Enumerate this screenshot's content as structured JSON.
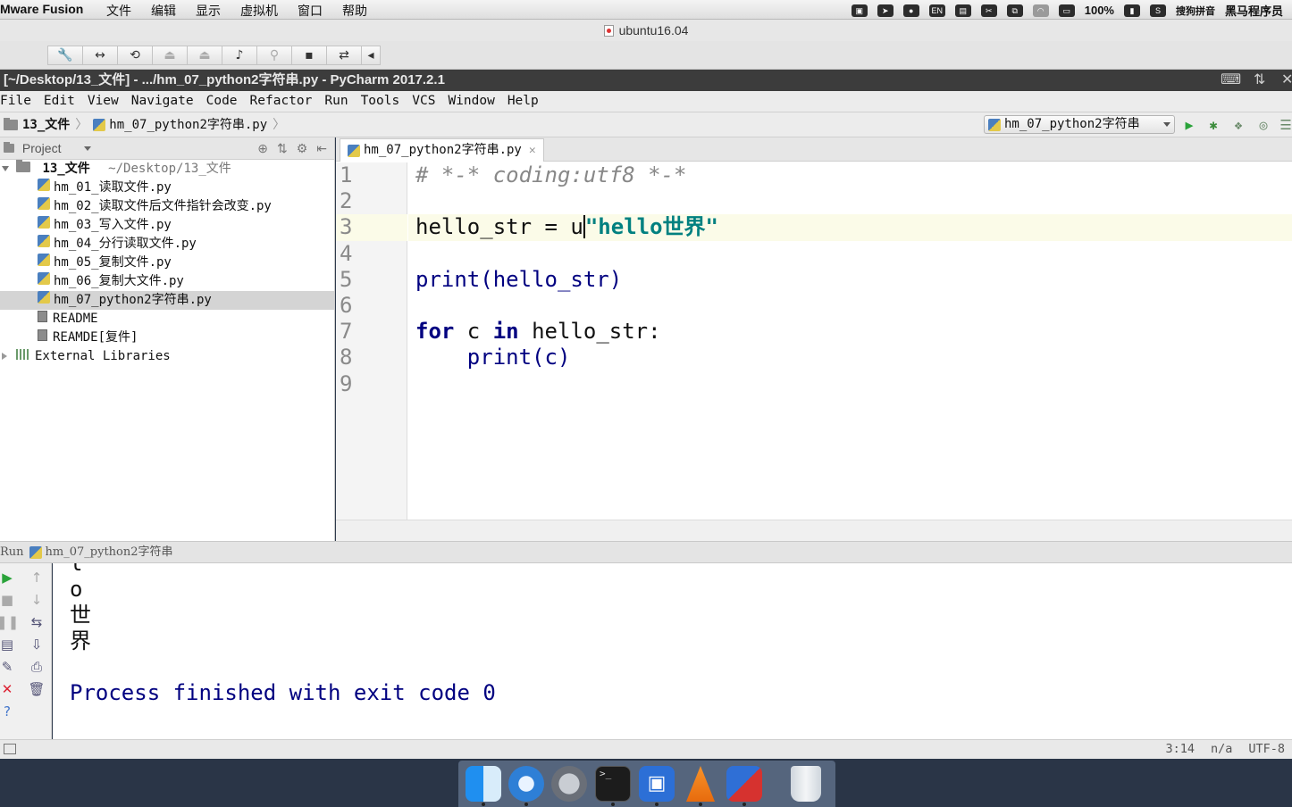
{
  "macbar": {
    "app": "Mware Fusion",
    "menus": [
      "文件",
      "编辑",
      "显示",
      "虚拟机",
      "窗口",
      "帮助"
    ],
    "battery": "100%",
    "input_method": "搜狗拼音",
    "user": "黑马程序员"
  },
  "vm": {
    "title": "ubuntu16.04"
  },
  "pycharm": {
    "title": "[~/Desktop/13_文件] - .../hm_07_python2字符串.py - PyCharm 2017.2.1",
    "menu": [
      "File",
      "Edit",
      "View",
      "Navigate",
      "Code",
      "Refactor",
      "Run",
      "Tools",
      "VCS",
      "Window",
      "Help"
    ],
    "breadcrumb": [
      "13_文件",
      "hm_07_python2字符串.py"
    ],
    "run_config": "hm_07_python2字符串"
  },
  "project": {
    "header": "Project",
    "root": "13_文件",
    "root_path": "~/Desktop/13_文件",
    "files": [
      "hm_01_读取文件.py",
      "hm_02_读取文件后文件指针会改变.py",
      "hm_03_写入文件.py",
      "hm_04_分行读取文件.py",
      "hm_05_复制文件.py",
      "hm_06_复制大文件.py",
      "hm_07_python2字符串.py",
      "README",
      "REAMDE[复件]"
    ],
    "external": "External Libraries"
  },
  "editor": {
    "tab": "hm_07_python2字符串.py",
    "line_numbers": [
      "1",
      "2",
      "3",
      "4",
      "5",
      "6",
      "7",
      "8",
      "9"
    ],
    "code": {
      "l1": "# *-* coding:utf8 *-*",
      "l3a": "hello_str = u",
      "l3b": "\"hello世界\"",
      "l5": "print(hello_str)",
      "l7_for": "for",
      "l7_c": " c ",
      "l7_in": "in",
      "l7_rest": " hello_str:",
      "l8": "    print(c)"
    }
  },
  "run": {
    "label": "Run",
    "config": "hm_07_python2字符串",
    "output": [
      "l",
      "o",
      "世",
      "界",
      "",
      "Process finished with exit code 0"
    ]
  },
  "status": {
    "position": "3:14",
    "line_sep": "n/a",
    "encoding": "UTF-8"
  }
}
